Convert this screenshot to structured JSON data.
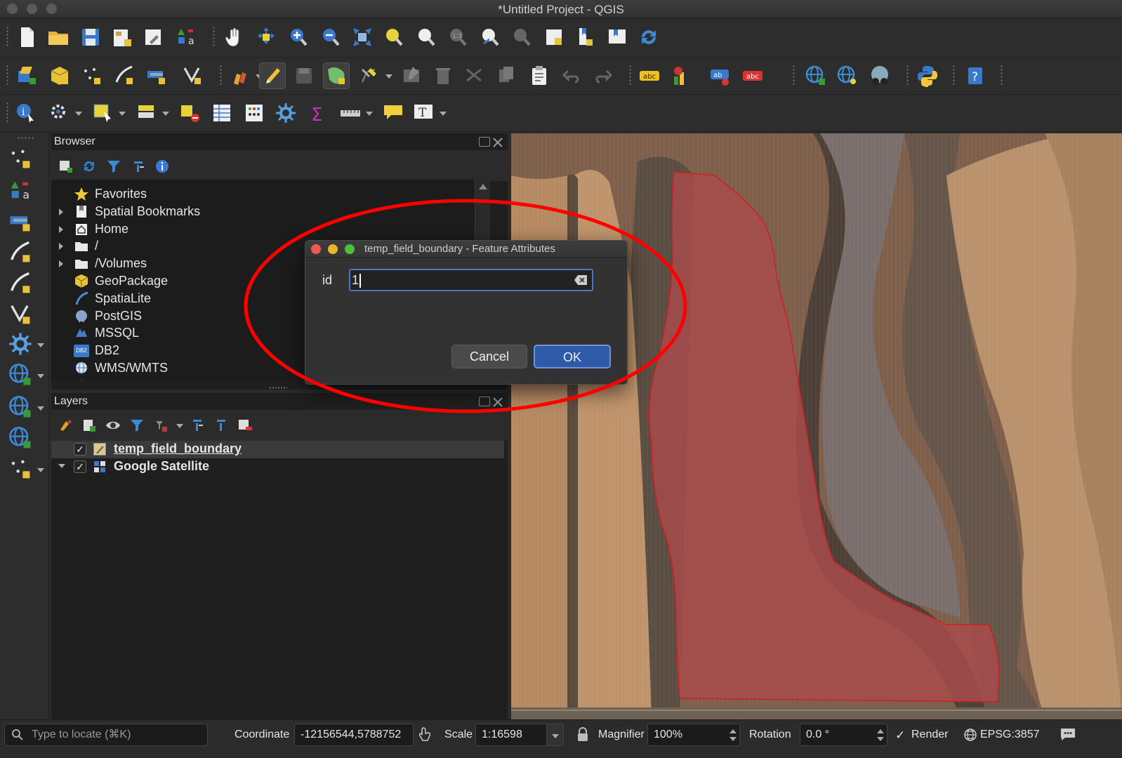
{
  "window": {
    "title": "*Untitled Project - QGIS"
  },
  "toolbars": {
    "row1": [
      "new-project-icon",
      "open-project-icon",
      "save-project-icon",
      "new-print-layout-icon",
      "layout-manager-icon",
      "style-manager-icon",
      "pan-map-icon",
      "pan-to-selection-icon",
      "zoom-in-icon",
      "zoom-out-icon",
      "zoom-full-icon",
      "zoom-to-selection-icon",
      "zoom-to-layer-icon",
      "zoom-to-native-resolution-icon",
      "zoom-last-icon",
      "zoom-next-icon",
      "new-map-view-icon",
      "new-bookmark-icon",
      "show-bookmarks-icon",
      "refresh-icon"
    ],
    "row2": [
      "open-data-source-manager-icon",
      "new-geopackage-layer-icon",
      "new-temporary-scratch-layer-icon",
      "digitize-line-icon",
      "add-raster-layer-icon",
      "add-vector-layer-icon",
      "current-edits-icon",
      "toggle-editing-icon",
      "save-layer-edits-icon",
      "add-polygon-feature-icon",
      "vertex-tool-icon",
      "modify-attributes-icon",
      "delete-selected-icon",
      "cut-features-icon",
      "copy-features-icon",
      "paste-features-icon",
      "undo-icon",
      "redo-icon",
      "label-tool-icon",
      "diagram-tool-icon",
      "pin-label-icon",
      "highlight-label-icon",
      "metasearch-icon",
      "web-service-icon",
      "osm-tool-icon",
      "python-console-icon",
      "help-icon"
    ],
    "row3": [
      "identify-features-icon",
      "run-feature-action-icon",
      "select-features-icon",
      "select-by-value-icon",
      "deselect-features-icon",
      "open-attribute-table-icon",
      "field-calculator-icon",
      "toolbox-icon",
      "statistical-summary-icon",
      "measure-line-icon",
      "map-tips-icon",
      "text-annotation-icon"
    ]
  },
  "left_toolbar": [
    "add-vector-point-icon",
    "add-xyz-layer-icon",
    "add-wms-layer-icon",
    "add-delimited-text-icon",
    "add-spatialite-layer-icon",
    "add-virtual-layer-icon",
    "add-postgis-layer-icon",
    "add-wfs-layer-icon",
    "add-wcs-layer-icon",
    "add-arcgis-layer-icon",
    "add-point-cloud-icon"
  ],
  "browser": {
    "title": "Browser",
    "items": [
      {
        "label": "Favorites",
        "icon": "star-icon",
        "expandable": false
      },
      {
        "label": "Spatial Bookmarks",
        "icon": "bookmark-icon",
        "expandable": true
      },
      {
        "label": "Home",
        "icon": "home-icon",
        "expandable": true
      },
      {
        "label": "/",
        "icon": "folder-icon",
        "expandable": true
      },
      {
        "label": "/Volumes",
        "icon": "folder-icon",
        "expandable": true
      },
      {
        "label": "GeoPackage",
        "icon": "geopackage-icon",
        "expandable": false
      },
      {
        "label": "SpatiaLite",
        "icon": "spatialite-icon",
        "expandable": false
      },
      {
        "label": "PostGIS",
        "icon": "postgis-icon",
        "expandable": false
      },
      {
        "label": "MSSQL",
        "icon": "mssql-icon",
        "expandable": false
      },
      {
        "label": "DB2",
        "icon": "db2-icon",
        "expandable": false
      },
      {
        "label": "WMS/WMTS",
        "icon": "globe-icon",
        "expandable": false
      },
      {
        "label": "XYZ Tiles",
        "icon": "globe-icon",
        "expandable": true
      }
    ],
    "db2_badge": "DB2"
  },
  "layers": {
    "title": "Layers",
    "items": [
      {
        "label": "temp_field_boundary",
        "checked": true,
        "selected": true
      },
      {
        "label": "Google Satellite",
        "checked": true,
        "selected": false
      }
    ]
  },
  "dialog": {
    "title": "temp_field_boundary - Feature Attributes",
    "field_label": "id",
    "field_value": "1",
    "cancel_label": "Cancel",
    "ok_label": "OK"
  },
  "status": {
    "locate_placeholder": "Type to locate (⌘K)",
    "coordinate_label": "Coordinate",
    "coordinate_value": "-12156544,5788752",
    "scale_label": "Scale",
    "scale_value": "1:16598",
    "magnifier_label": "Magnifier",
    "magnifier_value": "100%",
    "rotation_label": "Rotation",
    "rotation_value": "0.0 °",
    "render_label": "Render",
    "render_checked": true,
    "crs_label": "EPSG:3857"
  },
  "colors": {
    "accent": "#2f5aa8",
    "boundary": "#d21e1e",
    "annotation": "#ff0000"
  }
}
